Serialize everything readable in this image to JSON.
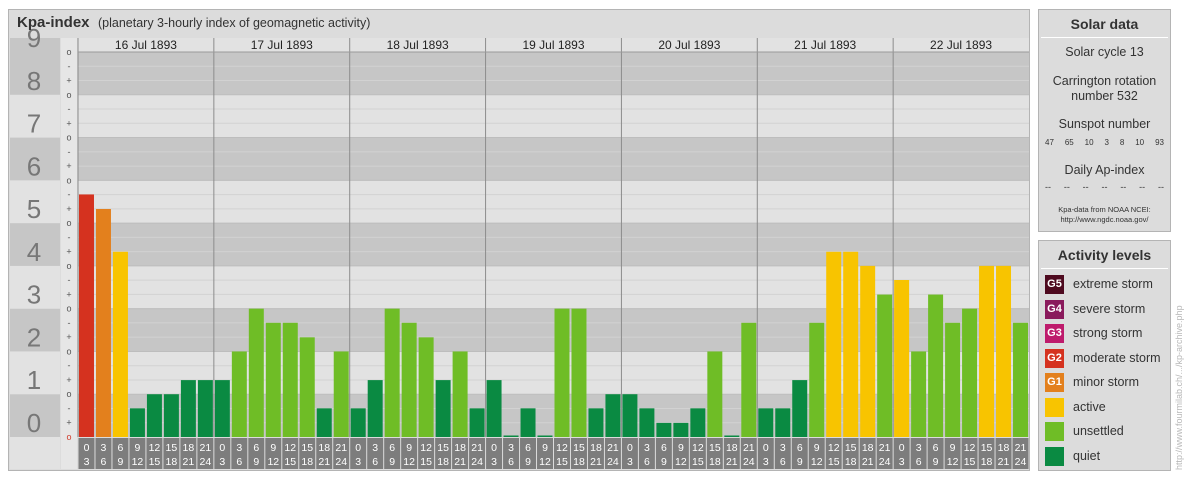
{
  "header": {
    "title": "Kpa-index",
    "subtitle": "(planetary 3-hourly index of geomagnetic activity)"
  },
  "chart_data": {
    "type": "bar",
    "title": "Kpa-index",
    "subtitle": "(planetary 3-hourly index of geomagnetic activity)",
    "ylim": [
      0,
      9
    ],
    "y_ticks": [
      "0",
      "1",
      "2",
      "3",
      "4",
      "5",
      "6",
      "7",
      "8",
      "9"
    ],
    "minor_ticks": [
      "o",
      "+",
      "-"
    ],
    "interval_top": [
      "0",
      "3",
      "6",
      "9",
      "12",
      "15",
      "18",
      "21"
    ],
    "interval_bottom": [
      "3",
      "6",
      "9",
      "12",
      "15",
      "18",
      "21",
      "24"
    ],
    "days": [
      {
        "label": "16 Jul 1893",
        "values": [
          5.67,
          5.33,
          4.33,
          0.67,
          1.0,
          1.0,
          1.33,
          1.33
        ]
      },
      {
        "label": "17 Jul 1893",
        "values": [
          1.33,
          2.0,
          3.0,
          2.67,
          2.67,
          2.33,
          0.67,
          2.0
        ]
      },
      {
        "label": "18 Jul 1893",
        "values": [
          0.67,
          1.33,
          3.0,
          2.67,
          2.33,
          1.33,
          2.0,
          0.67
        ]
      },
      {
        "label": "19 Jul 1893",
        "values": [
          1.33,
          0.0,
          0.67,
          0.0,
          3.0,
          3.0,
          0.67,
          1.0
        ]
      },
      {
        "label": "20 Jul 1893",
        "values": [
          1.0,
          0.67,
          0.33,
          0.33,
          0.67,
          2.0,
          0.0,
          2.67
        ]
      },
      {
        "label": "21 Jul 1893",
        "values": [
          0.67,
          0.67,
          1.33,
          2.67,
          4.33,
          4.33,
          4.0,
          3.33
        ]
      },
      {
        "label": "22 Jul 1893",
        "values": [
          3.67,
          2.0,
          3.33,
          2.67,
          3.0,
          4.0,
          4.0,
          2.67
        ]
      }
    ],
    "colors": {
      "quiet": "#0a8a42",
      "unsettled": "#6fbd26",
      "active": "#f8c400",
      "G1": "#e3801d",
      "G2": "#d5321f"
    },
    "grid": true
  },
  "solar": {
    "title": "Solar data",
    "cycle": "Solar cycle 13",
    "carrington_line1": "Carrington rotation",
    "carrington_line2": "number 532",
    "sunspot_title": "Sunspot number",
    "sunspots": [
      "47",
      "65",
      "10",
      "3",
      "8",
      "10",
      "93"
    ],
    "ap_title": "Daily Ap-index",
    "ap_values": [
      "--",
      "--",
      "--",
      "--",
      "--",
      "--",
      "--"
    ],
    "credit_line1": "Kpa-data from NOAA NCEI:",
    "credit_line2": "http://www.ngdc.noaa.gov/"
  },
  "levels": {
    "title": "Activity levels",
    "items": [
      {
        "badge": "G5",
        "label": "extreme storm",
        "color": "#4e0a1f"
      },
      {
        "badge": "G4",
        "label": "severe storm",
        "color": "#8a1a5c"
      },
      {
        "badge": "G3",
        "label": "strong storm",
        "color": "#be1b6c"
      },
      {
        "badge": "G2",
        "label": "moderate storm",
        "color": "#d5321f"
      },
      {
        "badge": "G1",
        "label": "minor storm",
        "color": "#e3801d"
      },
      {
        "badge": "",
        "label": "active",
        "color": "#f8c400"
      },
      {
        "badge": "",
        "label": "unsettled",
        "color": "#6fbd26"
      },
      {
        "badge": "",
        "label": "quiet",
        "color": "#0a8a42"
      }
    ]
  },
  "watermark": "http://www.fourmilab.ch/.../kp-archive.php"
}
